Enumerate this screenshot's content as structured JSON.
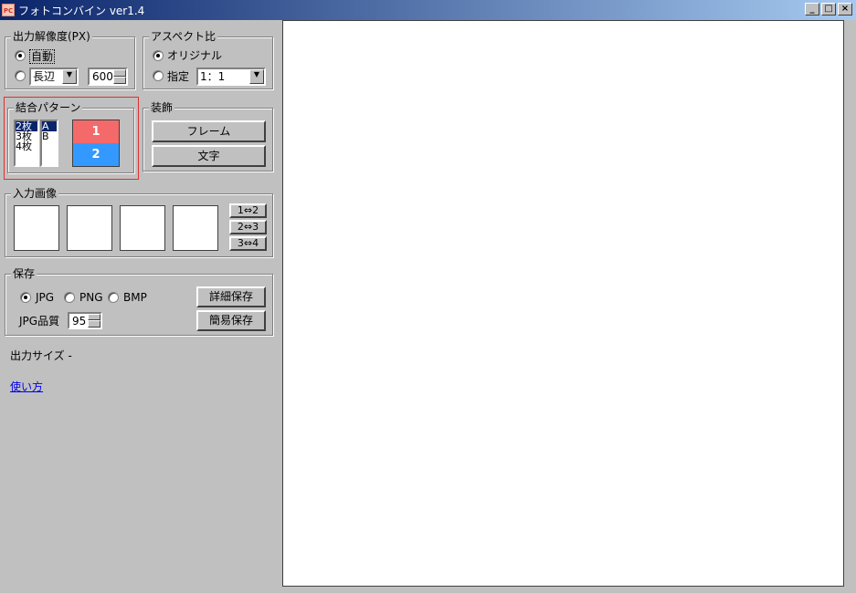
{
  "window": {
    "title": "フォトコンバイン ver1.4",
    "icon_text": "PC",
    "controls": {
      "minimize": "_",
      "maximize": "□",
      "close": "×"
    }
  },
  "resolution": {
    "legend": "出力解像度(PX)",
    "auto_label": "自動",
    "side_value": "長辺",
    "size_value": "600"
  },
  "aspect": {
    "legend": "アスペクト比",
    "original_label": "オリジナル",
    "specify_label": "指定",
    "ratio_value": "1：1"
  },
  "pattern": {
    "legend": "結合パターン",
    "counts": [
      "2枚",
      "3枚",
      "4枚"
    ],
    "types": [
      "A",
      "B"
    ],
    "preview": {
      "top": "1",
      "bottom": "2",
      "top_color": "#f46a6a",
      "bottom_color": "#3399ff"
    }
  },
  "decoration": {
    "legend": "装飾",
    "frame_label": "フレーム",
    "text_label": "文字"
  },
  "input": {
    "legend": "入力画像",
    "swap_labels": [
      "1⇔2",
      "2⇔3",
      "3⇔4"
    ]
  },
  "save": {
    "legend": "保存",
    "formats": [
      "JPG",
      "PNG",
      "BMP"
    ],
    "quality_label": "JPG品質",
    "quality_value": "95",
    "detail_label": "詳細保存",
    "simple_label": "簡易保存"
  },
  "output_size": "出力サイズ -",
  "usage_link": "使い方"
}
